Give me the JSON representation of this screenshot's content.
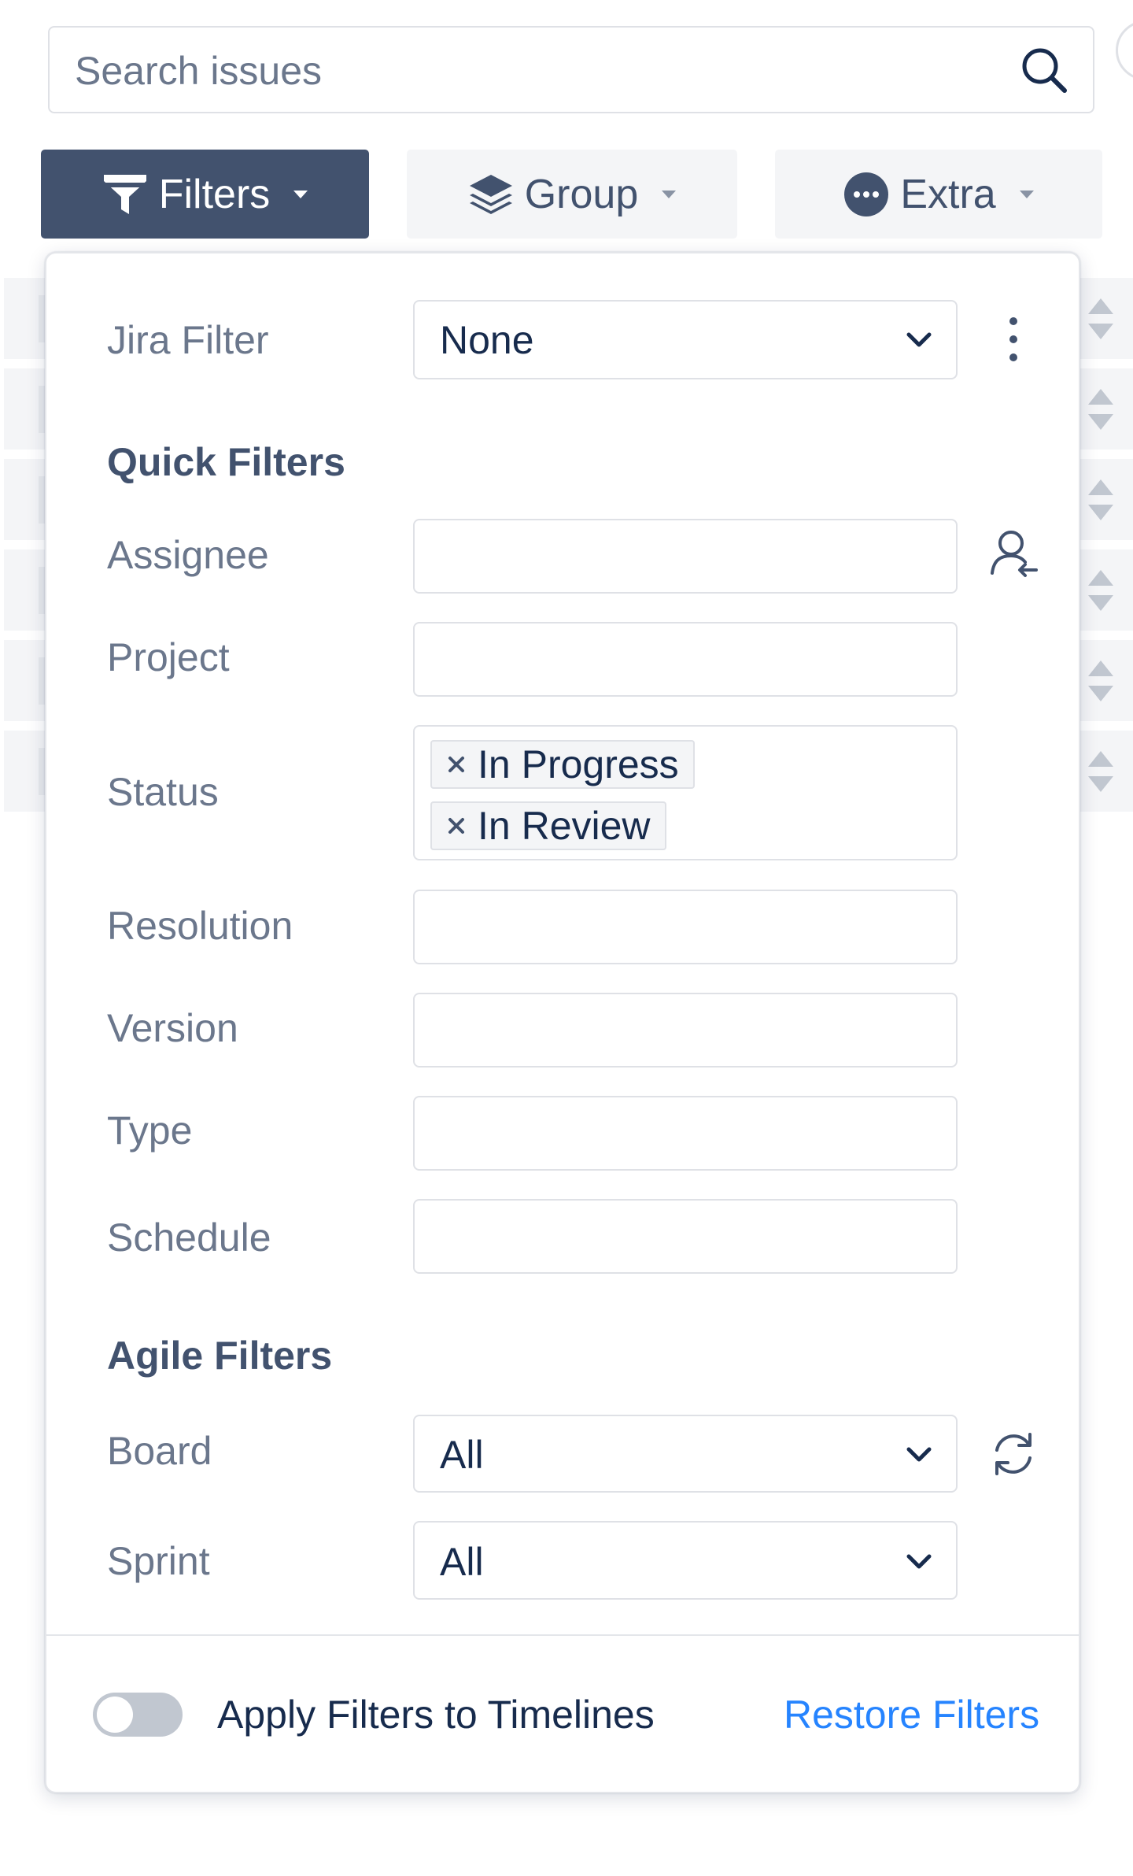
{
  "search": {
    "placeholder": "Search issues"
  },
  "toolbar": {
    "filters_label": "Filters",
    "group_label": "Group",
    "extra_label": "Extra"
  },
  "panel": {
    "jira_filter": {
      "label": "Jira Filter",
      "value": "None"
    },
    "quick_filters": {
      "heading": "Quick Filters",
      "assignee": {
        "label": "Assignee",
        "value": ""
      },
      "project": {
        "label": "Project",
        "value": ""
      },
      "status": {
        "label": "Status",
        "tags": [
          "In Progress",
          "In Review"
        ]
      },
      "resolution": {
        "label": "Resolution",
        "value": ""
      },
      "version": {
        "label": "Version",
        "value": ""
      },
      "type": {
        "label": "Type",
        "value": ""
      },
      "schedule": {
        "label": "Schedule",
        "value": ""
      }
    },
    "agile_filters": {
      "heading": "Agile Filters",
      "board": {
        "label": "Board",
        "value": "All"
      },
      "sprint": {
        "label": "Sprint",
        "value": "All"
      }
    },
    "footer": {
      "toggle_label": "Apply Filters to Timelines",
      "toggle_on": false,
      "restore_label": "Restore Filters"
    }
  },
  "colors": {
    "primary_button": "#42526e",
    "link": "#2684ff",
    "field_border": "#dfe1e6"
  }
}
